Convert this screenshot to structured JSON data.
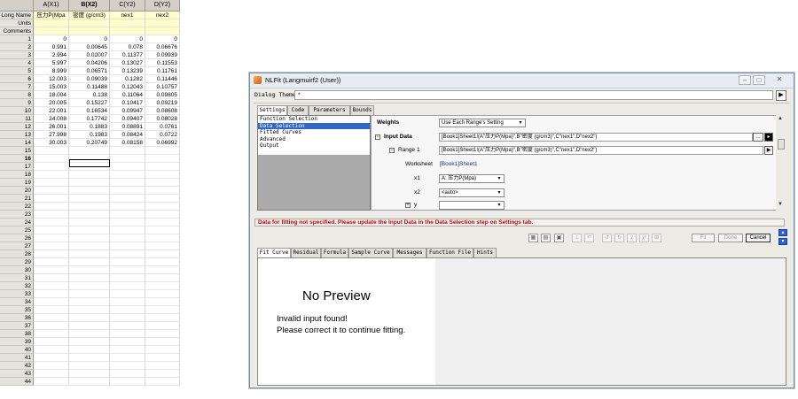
{
  "spreadsheet": {
    "columns": [
      {
        "header": "A(X1)",
        "long_name": "压力P(Mpa",
        "selected": false
      },
      {
        "header": "B(X2)",
        "long_name": "密度 (g/cm3)",
        "selected": true
      },
      {
        "header": "C(Y2)",
        "long_name": "nex1",
        "selected": false
      },
      {
        "header": "D(Y2)",
        "long_name": "nex2",
        "selected": false
      }
    ],
    "meta_labels": [
      "Long Name",
      "Units",
      "Comments"
    ],
    "rows": [
      {
        "num": "1",
        "cells": [
          "0",
          "0",
          "0",
          "0"
        ]
      },
      {
        "num": "2",
        "cells": [
          "0.991",
          "0.00645",
          "0.078",
          "0.06676"
        ]
      },
      {
        "num": "3",
        "cells": [
          "2.994",
          "0.02007",
          "0.11377",
          "0.09939"
        ]
      },
      {
        "num": "4",
        "cells": [
          "5.997",
          "0.04206",
          "0.13027",
          "0.11553"
        ]
      },
      {
        "num": "5",
        "cells": [
          "8.999",
          "0.06571",
          "0.13239",
          "0.11761"
        ]
      },
      {
        "num": "6",
        "cells": [
          "12.003",
          "0.09039",
          "0.1282",
          "0.11446"
        ]
      },
      {
        "num": "7",
        "cells": [
          "15.003",
          "0.11488",
          "0.12043",
          "0.10757"
        ]
      },
      {
        "num": "8",
        "cells": [
          "18.004",
          "0.138",
          "0.11064",
          "0.09805"
        ]
      },
      {
        "num": "9",
        "cells": [
          "20.005",
          "0.15227",
          "0.10417",
          "0.09219"
        ]
      },
      {
        "num": "10",
        "cells": [
          "22.001",
          "0.16534",
          "0.09947",
          "0.08608"
        ]
      },
      {
        "num": "11",
        "cells": [
          "24.008",
          "0.17742",
          "0.09407",
          "0.08028"
        ]
      },
      {
        "num": "12",
        "cells": [
          "26.001",
          "0.1883",
          "0.08891",
          "0.0761"
        ]
      },
      {
        "num": "13",
        "cells": [
          "27.998",
          "0.1983",
          "0.08424",
          "0.0722"
        ]
      },
      {
        "num": "14",
        "cells": [
          "30.003",
          "0.20749",
          "0.08158",
          "0.06992"
        ]
      },
      {
        "num": "15",
        "cells": [
          "",
          "",
          "",
          ""
        ]
      },
      {
        "num": "16",
        "cells": [
          "",
          "",
          "",
          ""
        ]
      },
      {
        "num": "17",
        "cells": [
          "",
          "",
          "",
          ""
        ]
      },
      {
        "num": "18",
        "cells": [
          "",
          "",
          "",
          ""
        ]
      },
      {
        "num": "19",
        "cells": [
          "",
          "",
          "",
          ""
        ]
      },
      {
        "num": "20",
        "cells": [
          "",
          "",
          "",
          ""
        ]
      },
      {
        "num": "21",
        "cells": [
          "",
          "",
          "",
          ""
        ]
      },
      {
        "num": "22",
        "cells": [
          "",
          "",
          "",
          ""
        ]
      },
      {
        "num": "23",
        "cells": [
          "",
          "",
          "",
          ""
        ]
      },
      {
        "num": "24",
        "cells": [
          "",
          "",
          "",
          ""
        ]
      },
      {
        "num": "25",
        "cells": [
          "",
          "",
          "",
          ""
        ]
      },
      {
        "num": "26",
        "cells": [
          "",
          "",
          "",
          ""
        ]
      },
      {
        "num": "27",
        "cells": [
          "",
          "",
          "",
          ""
        ]
      },
      {
        "num": "28",
        "cells": [
          "",
          "",
          "",
          ""
        ]
      },
      {
        "num": "29",
        "cells": [
          "",
          "",
          "",
          ""
        ]
      },
      {
        "num": "30",
        "cells": [
          "",
          "",
          "",
          ""
        ]
      },
      {
        "num": "31",
        "cells": [
          "",
          "",
          "",
          ""
        ]
      },
      {
        "num": "32",
        "cells": [
          "",
          "",
          "",
          ""
        ]
      },
      {
        "num": "33",
        "cells": [
          "",
          "",
          "",
          ""
        ]
      },
      {
        "num": "34",
        "cells": [
          "",
          "",
          "",
          ""
        ]
      },
      {
        "num": "35",
        "cells": [
          "",
          "",
          "",
          ""
        ]
      },
      {
        "num": "36",
        "cells": [
          "",
          "",
          "",
          ""
        ]
      },
      {
        "num": "37",
        "cells": [
          "",
          "",
          "",
          ""
        ]
      },
      {
        "num": "38",
        "cells": [
          "",
          "",
          "",
          ""
        ]
      },
      {
        "num": "39",
        "cells": [
          "",
          "",
          "",
          ""
        ]
      },
      {
        "num": "40",
        "cells": [
          "",
          "",
          "",
          ""
        ]
      },
      {
        "num": "41",
        "cells": [
          "",
          "",
          "",
          ""
        ]
      },
      {
        "num": "42",
        "cells": [
          "",
          "",
          "",
          ""
        ]
      },
      {
        "num": "43",
        "cells": [
          "",
          "",
          "",
          ""
        ]
      },
      {
        "num": "44",
        "cells": [
          "",
          "",
          "",
          ""
        ]
      }
    ],
    "active_row": "16"
  },
  "dialog": {
    "title": "NLFit (Langmuirf2 (User))",
    "theme_label": "Dialog Theme",
    "theme_value": "*",
    "settings_tabs": [
      "Settings",
      "Code",
      "Parameters",
      "Bounds"
    ],
    "nav_items": [
      "Function Selection",
      "Data Selection",
      "Fitted Curves",
      "Advanced",
      "Output"
    ],
    "nav_selected": "Data Selection",
    "weights_label": "Weights",
    "weights_value": "Use Each Range's Setting",
    "input_data_label": "Input Data",
    "input_data_value": "[Book1]Sheet1!(A\"压力P(Mpa)\",B\"密度 (g/cm3)\",C\"nex1\",D\"nex2\")",
    "range_label": "Range 1",
    "range_value": "[Book1]Sheet1!(A\"压力P(Mpa)\",B\"密度 (g/cm3)\",C\"nex1\",D\"nex2\")",
    "worksheet_label": "Worksheet",
    "worksheet_value": "[Book1]Sheet1",
    "x1_label": "x1",
    "x1_value": "A: 压力P(Mpa)",
    "x2_label": "x2",
    "x2_value": "<auto>",
    "y_label": "y",
    "y_value": "",
    "error_message": "Data for fitting not specified. Please update the Input Data in the Data Selection step on Settings tab.",
    "fit_button": "Fit",
    "done_button": "Done",
    "cancel_button": "Cancel",
    "preview_tabs": [
      "Fit Curve",
      "Residual",
      "Formula",
      "Sample Curve",
      "Messages",
      "Function File",
      "Hints"
    ],
    "no_preview": "No Preview",
    "preview_msg1": "Invalid input found!",
    "preview_msg2": "Please correct it to continue fitting."
  }
}
